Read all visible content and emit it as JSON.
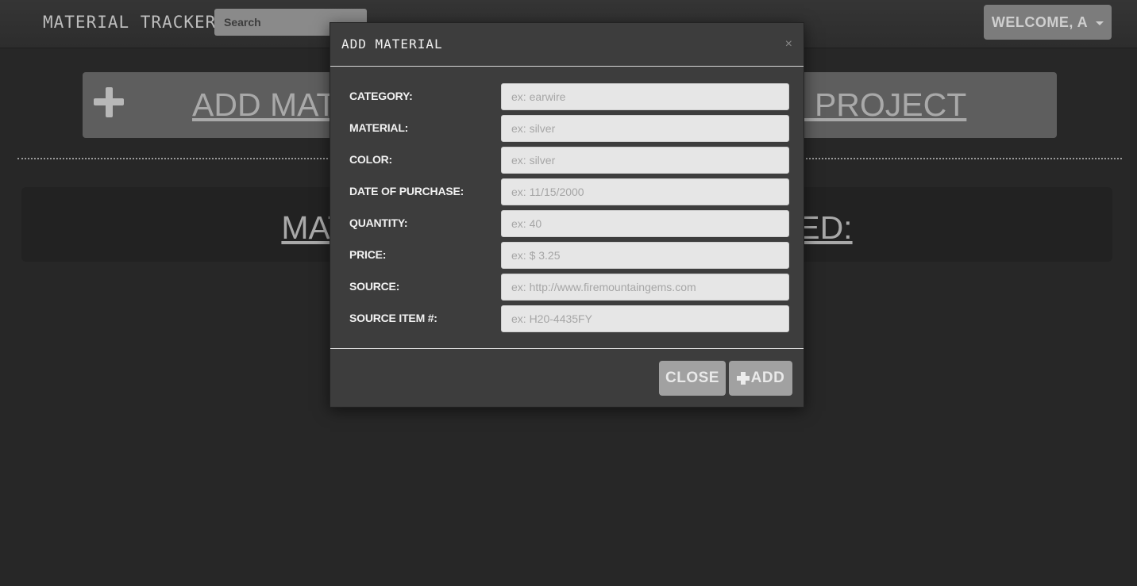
{
  "navbar": {
    "brand": "MATERIAL TRACKER",
    "search_placeholder": "Search",
    "welcome_label": "WELCOME, A"
  },
  "page": {
    "add_material_label": "ADD MATERIAL",
    "add_project_label": "ADD PROJECT",
    "materials_heading": "MATERIALS AND PROJECTS ADDED:"
  },
  "modal": {
    "title": "ADD MATERIAL",
    "close_glyph": "×",
    "fields": [
      {
        "label": "CATEGORY:",
        "placeholder": "ex: earwire"
      },
      {
        "label": "MATERIAL:",
        "placeholder": "ex: silver"
      },
      {
        "label": "COLOR:",
        "placeholder": "ex: silver"
      },
      {
        "label": "DATE OF PURCHASE:",
        "placeholder": "ex: 11/15/2000"
      },
      {
        "label": "QUANTITY:",
        "placeholder": "ex: 40"
      },
      {
        "label": "PRICE:",
        "placeholder": "ex: $ 3.25"
      },
      {
        "label": "SOURCE:",
        "placeholder": "ex: http://www.firemountaingems.com"
      },
      {
        "label": "SOURCE ITEM #:",
        "placeholder": "ex: H20-4435FY"
      }
    ],
    "close_button": "CLOSE",
    "add_button": "ADD"
  },
  "colors": {
    "background": "#272727",
    "modal": "#3d3d3d",
    "button": "#a1a1a1"
  },
  "icons": [
    "plus-icon",
    "close-icon",
    "caret-down-icon"
  ]
}
